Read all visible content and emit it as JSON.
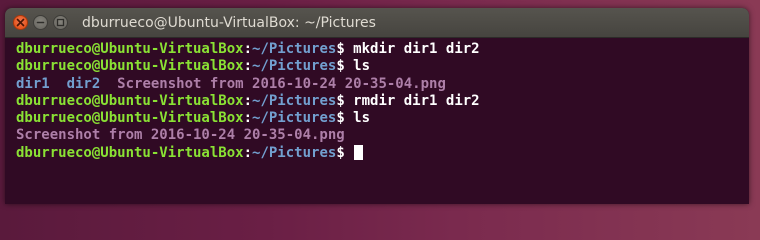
{
  "window": {
    "title": "dburrueco@Ubuntu-VirtualBox: ~/Pictures"
  },
  "controls": {
    "close_icon": "close-icon",
    "minimize_icon": "minimize-icon",
    "maximize_icon": "maximize-icon"
  },
  "colors": {
    "background": "#300a24",
    "prompt_user": "#8ae234",
    "prompt_path": "#729fcf",
    "directory": "#729fcf",
    "file": "#ad7fa8",
    "text": "#ffffff"
  },
  "prompt": {
    "user": "dburrueco@Ubuntu-VirtualBox",
    "separator": ":",
    "path": "~/Pictures",
    "symbol": "$ "
  },
  "lines": [
    {
      "type": "prompt",
      "command": "mkdir dir1 dir2"
    },
    {
      "type": "prompt",
      "command": "ls"
    },
    {
      "type": "output",
      "items": [
        {
          "text": "dir1",
          "kind": "dir"
        },
        {
          "text": "  ",
          "kind": "space"
        },
        {
          "text": "dir2",
          "kind": "dir"
        },
        {
          "text": "  ",
          "kind": "space"
        },
        {
          "text": "Screenshot from 2016-10-24 20-35-04.png",
          "kind": "file"
        }
      ]
    },
    {
      "type": "prompt",
      "command": "rmdir dir1 dir2"
    },
    {
      "type": "prompt",
      "command": "ls"
    },
    {
      "type": "output",
      "items": [
        {
          "text": "Screenshot from 2016-10-24 20-35-04.png",
          "kind": "file"
        }
      ]
    },
    {
      "type": "prompt",
      "command": "",
      "cursor": true
    }
  ]
}
